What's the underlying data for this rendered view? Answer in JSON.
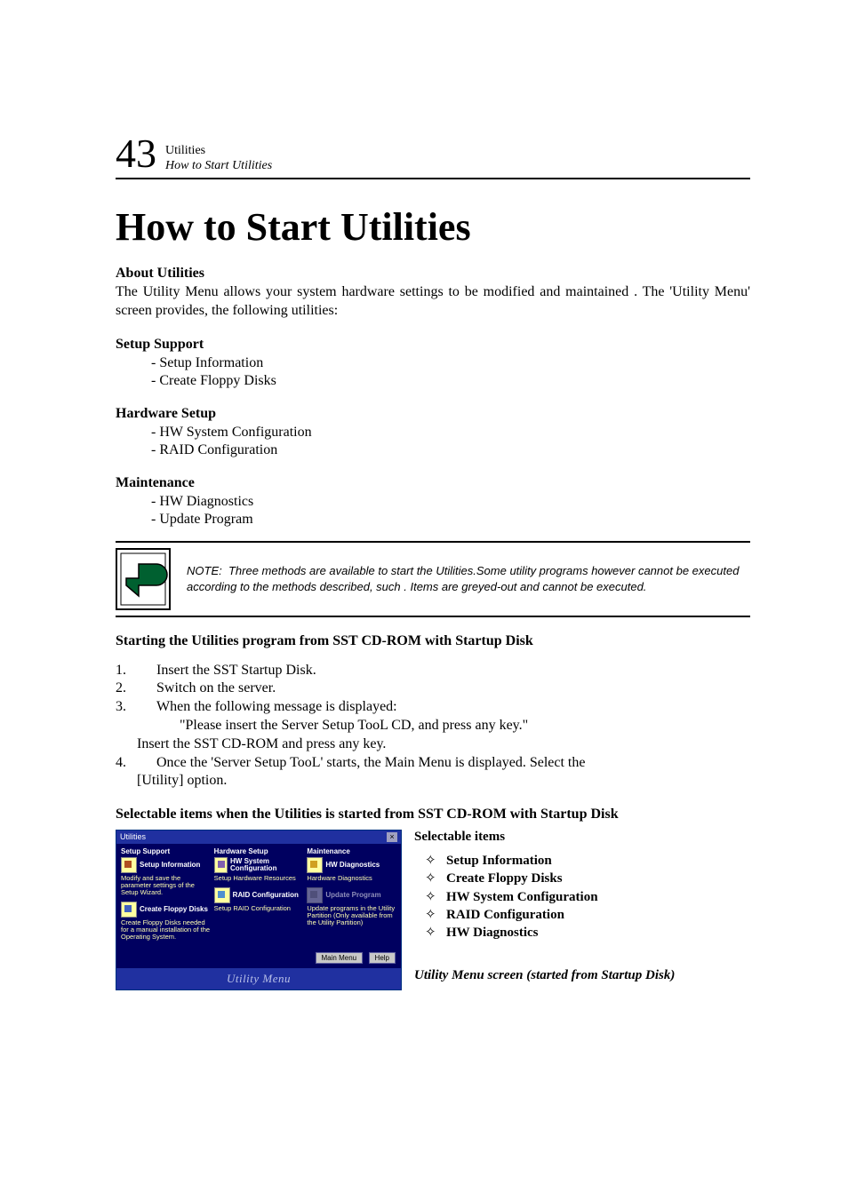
{
  "header": {
    "page_number": "43",
    "chapter": "Utilities",
    "section": "How to Start Utilities"
  },
  "title": "How to Start Utilities",
  "about": {
    "heading": "About Utilities",
    "text": "The Utility Menu allows your system hardware settings to be modified and maintained . The 'Utility Menu' screen provides, the following utilities:"
  },
  "groups": [
    {
      "heading": "Setup Support",
      "items": [
        "- Setup Information",
        "- Create Floppy Disks"
      ]
    },
    {
      "heading": "Hardware Setup",
      "items": [
        "- HW System Configuration",
        "- RAID Configuration"
      ]
    },
    {
      "heading": "Maintenance",
      "items": [
        "- HW Diagnostics",
        "- Update Program"
      ]
    }
  ],
  "note": {
    "label": "NOTE:",
    "text": "Three methods are available to  start the Utilities.Some utility programs however cannot be executed according to the methods described, such . Items are greyed-out and cannot be executed."
  },
  "starting": {
    "heading": "Starting the Utilities program from SST CD-ROM with Startup Disk",
    "steps": [
      {
        "n": "1.",
        "t": "Insert the SST Startup Disk."
      },
      {
        "n": "2.",
        "t": "Switch on the server."
      },
      {
        "n": "3.",
        "t": "When the following  message is displayed:"
      }
    ],
    "step3_quote": "\"Please insert the Server Setup TooL CD, and press any key.\"",
    "step3_tail": "Insert the SST CD-ROM and press any key.",
    "step4_n": "4.",
    "step4a": "Once the 'Server Setup TooL' starts, the Main Menu is displayed. Select the",
    "step4b": "[Utility] option."
  },
  "sel_heading": "Selectable items when the Utilities is started from SST CD-ROM with Startup Disk",
  "screenshot": {
    "window_title": "Utilities",
    "cols": [
      {
        "h": "Setup Support",
        "items": [
          {
            "label": "Setup Information",
            "desc": "Modify and save the parameter settings of the Setup Wizard.",
            "icon": "info"
          },
          {
            "label": "Create Floppy Disks",
            "desc": "Create Floppy Disks needed for a manual installation of the Operating System.",
            "icon": "disk"
          }
        ]
      },
      {
        "h": "Hardware Setup",
        "items": [
          {
            "label": "HW System Configuration",
            "desc": "Setup Hardware Resources",
            "icon": "hw"
          },
          {
            "label": "RAID Configuration",
            "desc": "Setup RAID Configuration",
            "icon": "raid"
          }
        ]
      },
      {
        "h": "Maintenance",
        "items": [
          {
            "label": "HW Diagnostics",
            "desc": "Hardware Diagnostics",
            "icon": "diag"
          },
          {
            "label": "Update Program",
            "desc": "Update programs in the Utility Partition (Only available from the Utility Partition)",
            "icon": "upd",
            "disabled": true
          }
        ]
      }
    ],
    "btn_main": "Main Menu",
    "btn_help": "Help",
    "footer": "Utility Menu"
  },
  "side": {
    "heading": "Selectable items",
    "bullets": [
      "Setup Information",
      "Create Floppy Disks",
      "HW System Configuration",
      "RAID Configuration",
      "HW Diagnostics"
    ],
    "caption": "Utility Menu screen (started from Startup Disk)"
  }
}
